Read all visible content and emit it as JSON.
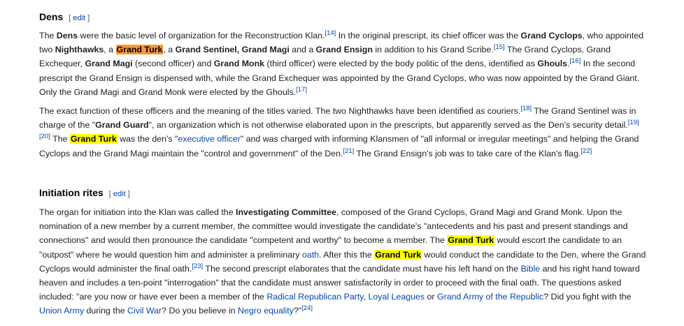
{
  "sections": {
    "dens": {
      "heading": "Dens",
      "edit": "edit"
    },
    "initiation": {
      "heading": "Initiation rites",
      "edit": "edit"
    }
  },
  "search_highlight": {
    "term": "Grand Turk",
    "current_color": "#ff9632",
    "match_color": "#ffff00"
  },
  "refs": {
    "r14": "[14]",
    "r15": "[15]",
    "r16": "[16]",
    "r17": "[17]",
    "r18": "[18]",
    "r19": "[19]",
    "r20": "[20]",
    "r21": "[21]",
    "r22": "[22]",
    "r23": "[23]",
    "r24": "[24]"
  },
  "links": {
    "executive_officer": "executive officer",
    "oath": "oath",
    "bible": "Bible",
    "radical_republican_party": "Radical Republican Party",
    "loyal_leagues": "Loyal Leagues",
    "grand_army": "Grand Army of the Republic",
    "union_army": "Union Army",
    "civil_war": "Civil War",
    "negro_equality": "Negro equality"
  },
  "p1": {
    "t1": "The ",
    "b1": "Dens",
    "t2": " were the basic level of organization for the Reconstruction Klan.",
    "t3": " In the original prescript, its chief officer was the ",
    "b2": "Grand Cyclops",
    "t4": ", who appointed two ",
    "b3": "Nighthawks",
    "t5": ", a ",
    "t6": ", a ",
    "b4": "Grand Sentinel, Grand Magi",
    "t7": " and a ",
    "b5": "Grand Ensign",
    "t8": " in addition to his Grand Scribe.",
    "t9": " The Grand Cyclops, Grand Exchequer, ",
    "b6": "Grand Magi",
    "t10": " (second officer) and ",
    "b7": "Grand Monk",
    "t11": " (third officer) were elected by the body politic of the dens, identified as ",
    "b8": "Ghouls",
    "t12": ".",
    "t13": " In the second prescript the Grand Ensign is dispensed with, while the Grand Exchequer was appointed by the Grand Cyclops, who was now appointed by the Grand Giant. Only the Grand Magi and Grand Monk were elected by the Ghouls."
  },
  "p2": {
    "t1": "The exact function of these officers and the meaning of the titles varied. The two Nighthawks have been identified as couriers.",
    "t2": " The Grand Sentinel was in charge of the \"",
    "b1": "Grand Guard",
    "t3": "\", an organization which is not otherwise elaborated upon in the prescripts, but apparently served as the Den's security detail.",
    "t4": " The ",
    "t5": " was the den's \"",
    "t6": "\" and was charged with informing Klansmen of \"all informal or irregular meetings\" and helping the Grand Cyclops and the Grand Magi maintain the \"control and government\" of the Den.",
    "t7": " The Grand Ensign's job was to take care of the Klan's flag."
  },
  "p3": {
    "t1": "The organ for initiation into the Klan was called the ",
    "b1": "Investigating Committee",
    "t2": ", composed of the Grand Cyclops, Grand Magi and Grand Monk. Upon the nomination of a new member by a current member, the committee would investigate the candidate's \"antecedents and his past and present standings and connections\" and would then pronounce the candidate \"competent and worthy\" to become a member. The ",
    "t3": " would escort the candidate to an \"outpost\" where he would question him and administer a preliminary ",
    "t4": ". After this the ",
    "t5": " would conduct the candidate to the Den, where the Grand Cyclops would administer the final oath.",
    "t6": " The second prescript elaborates that the candidate must have his left hand on the ",
    "t7": " and his right hand toward heaven and includes a ten-point \"interrogation\" that the candidate must answer satisfactorily in order to proceed with the final oath. The questions asked included: \"are you now or have ever been a member of the ",
    "t8": ", ",
    "t9": " or ",
    "t10": "? Did you fight with the ",
    "t11": " during the ",
    "t12": "? Do you believe in ",
    "t13": "?\""
  }
}
